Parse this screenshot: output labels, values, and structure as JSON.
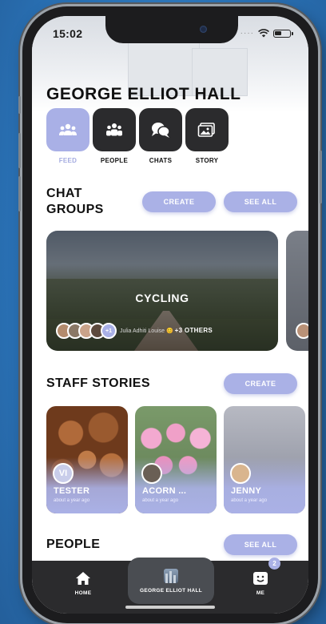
{
  "status_bar": {
    "time": "15:02"
  },
  "hall": {
    "title": "GEORGE ELLIOT HALL"
  },
  "nav": [
    {
      "label": "FEED",
      "icon": "people-group-icon",
      "active": true
    },
    {
      "label": "PEOPLE",
      "icon": "people-icon",
      "active": false
    },
    {
      "label": "CHATS",
      "icon": "chat-bubbles-icon",
      "active": false
    },
    {
      "label": "STORY",
      "icon": "photo-icon",
      "active": false
    }
  ],
  "chat_groups": {
    "title_line1": "CHAT",
    "title_line2": "GROUPS",
    "create_label": "CREATE",
    "see_all_label": "SEE ALL",
    "cards": [
      {
        "name": "CYCLING",
        "members_text": "Julia Adhiti Louise",
        "member_emoji": "😊",
        "others": "+3 OTHERS",
        "avatar_more": "+1"
      }
    ]
  },
  "staff_stories": {
    "title": "STAFF STORIES",
    "create_label": "CREATE",
    "items": [
      {
        "name": "TESTER",
        "time": "about a year ago",
        "avatar_initials": "VI"
      },
      {
        "name": "ACORN ...",
        "time": "about a year ago",
        "avatar_initials": ""
      },
      {
        "name": "JENNY",
        "time": "about a year ago",
        "avatar_initials": ""
      }
    ]
  },
  "people": {
    "title": "PEOPLE",
    "see_all_label": "SEE ALL"
  },
  "tabbar": {
    "home": "HOME",
    "hall": "GEORGE ELLIOT HALL",
    "me": "ME",
    "me_badge": "2"
  },
  "colors": {
    "accent": "#aab1e6",
    "dark_tile": "#2b2b2d",
    "background": "#2f7fc4"
  }
}
